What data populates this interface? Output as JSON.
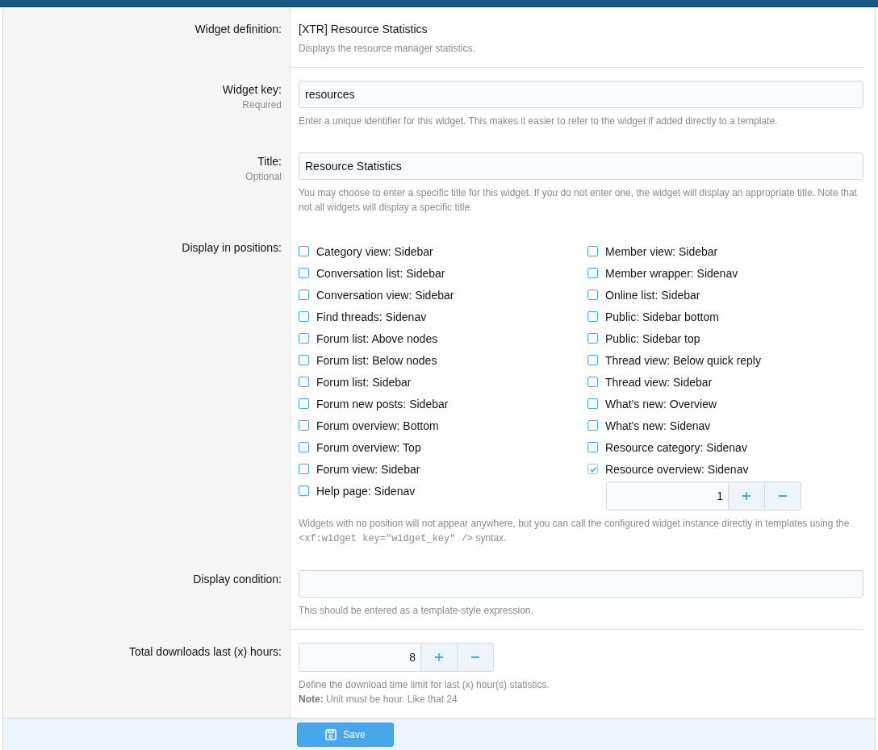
{
  "definition": {
    "label": "Widget definition:",
    "value": "[XTR] Resource Statistics",
    "hint": "Displays the resource manager statistics."
  },
  "widget_key": {
    "label": "Widget key:",
    "sublabel": "Required",
    "value": "resources",
    "hint": "Enter a unique identifier for this widget. This makes it easier to refer to the widget if added directly to a template."
  },
  "title": {
    "label": "Title:",
    "sublabel": "Optional",
    "value": "Resource Statistics",
    "hint": "You may choose to enter a specific title for this widget. If you do not enter one, the widget will display an appropriate title. Note that not all widgets will display a specific title."
  },
  "positions": {
    "label": "Display in positions:",
    "left_column": [
      {
        "label": "Category view: Sidebar",
        "checked": false
      },
      {
        "label": "Conversation list: Sidebar",
        "checked": false
      },
      {
        "label": "Conversation view: Sidebar",
        "checked": false
      },
      {
        "label": "Find threads: Sidenav",
        "checked": false
      },
      {
        "label": "Forum list: Above nodes",
        "checked": false
      },
      {
        "label": "Forum list: Below nodes",
        "checked": false
      },
      {
        "label": "Forum list: Sidebar",
        "checked": false
      },
      {
        "label": "Forum new posts: Sidebar",
        "checked": false
      },
      {
        "label": "Forum overview: Bottom",
        "checked": false
      },
      {
        "label": "Forum overview: Top",
        "checked": false
      },
      {
        "label": "Forum view: Sidebar",
        "checked": false
      },
      {
        "label": "Help page: Sidenav",
        "checked": false
      }
    ],
    "right_column": [
      {
        "label": "Member view: Sidebar",
        "checked": false
      },
      {
        "label": "Member wrapper: Sidenav",
        "checked": false
      },
      {
        "label": "Online list: Sidebar",
        "checked": false
      },
      {
        "label": "Public: Sidebar bottom",
        "checked": false
      },
      {
        "label": "Public: Sidebar top",
        "checked": false
      },
      {
        "label": "Thread view: Below quick reply",
        "checked": false
      },
      {
        "label": "Thread view: Sidebar",
        "checked": false
      },
      {
        "label": "What's new: Overview",
        "checked": false
      },
      {
        "label": "What's new: Sidenav",
        "checked": false
      },
      {
        "label": "Resource category: Sidenav",
        "checked": false
      },
      {
        "label": "Resource overview: Sidenav",
        "checked": true,
        "order": "1"
      }
    ],
    "hint_before": "Widgets with no position will not appear anywhere, but you can call the configured widget instance directly in templates using the ",
    "hint_code": "<xf:widget key=\"widget_key\" />",
    "hint_after": " syntax."
  },
  "condition": {
    "label": "Display condition:",
    "hint": "This should be entered as a template-style expression."
  },
  "downloads": {
    "label": "Total downloads last (x) hours:",
    "value": "8",
    "hint": "Define the download time limit for last (x) hour(s) statistics.",
    "note": "**Note:** Unit must be hour. Like that 24"
  },
  "save_button": "Save"
}
